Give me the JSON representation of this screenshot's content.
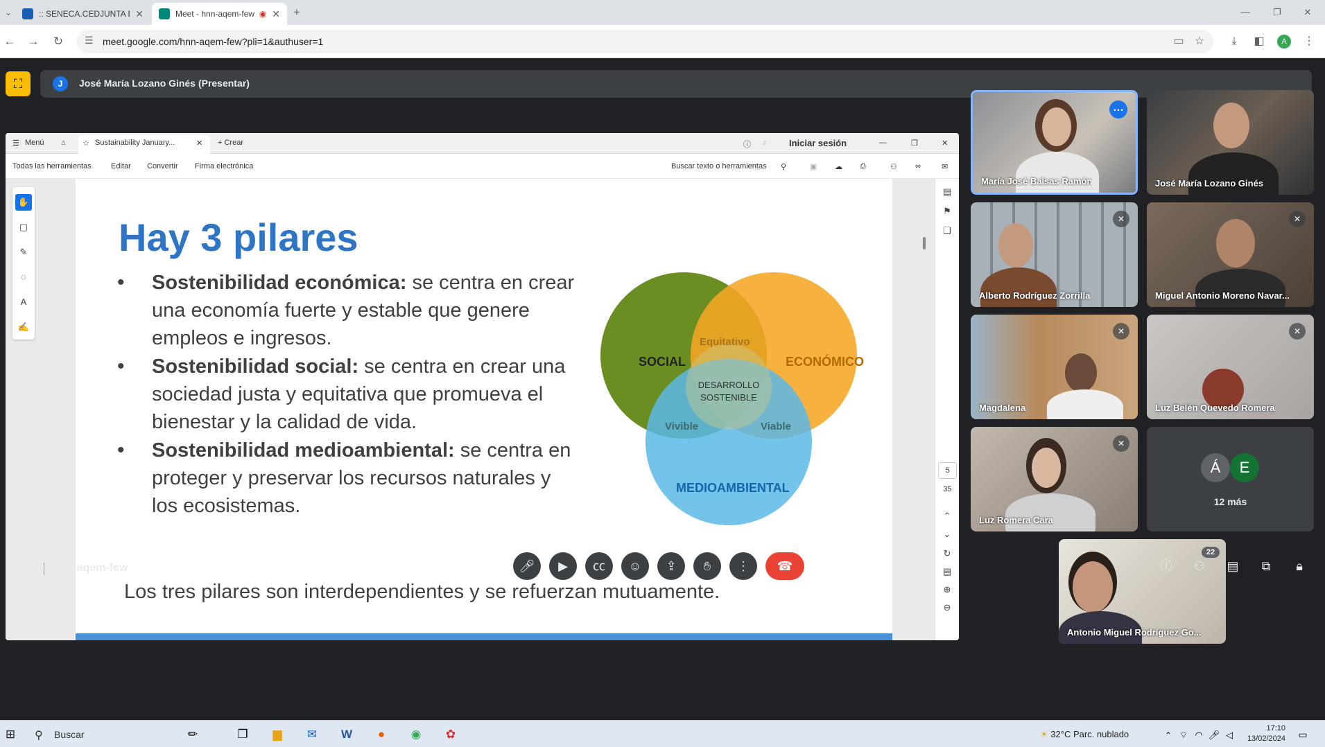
{
  "browser": {
    "tabs": [
      {
        "label": ":: SENECA.CEDJUNTA DE ANDALUCIA",
        "favicon_color": "#1a5fb4"
      },
      {
        "label": "Meet - hnn-aqem-few",
        "favicon_color": "#00897b"
      }
    ],
    "url": "meet.google.com/hnn-aqem-few?pli=1&authuser=1",
    "profile_initial": "A"
  },
  "meet": {
    "presenter_initial": "J",
    "presenter_label": "José María Lozano Ginés (Presentar)",
    "time": "17:10",
    "meeting_code": "hnn-aqem-few",
    "participants_count": "22",
    "more_label": "12 más",
    "more_initials": [
      "Á",
      "E"
    ],
    "tiles": [
      {
        "name": "María José Balsas Ramón"
      },
      {
        "name": "José María Lozano Ginés"
      },
      {
        "name": "Alberto Rodríguez Zorrilla"
      },
      {
        "name": "Miguel Antonio Moreno Navar..."
      },
      {
        "name": "Magdalena"
      },
      {
        "name": "Luz Belén Quevedo Romera"
      },
      {
        "name": "Luz Romera Cara"
      },
      {
        "name": "Antonio Miguel Rodríguez Go..."
      }
    ]
  },
  "acrobat": {
    "menu": "Menú",
    "doc_tab": "Sustainability January...",
    "create": "Crear",
    "sign_in": "Iniciar sesión",
    "toolbar": [
      "Todas las herramientas",
      "Editar",
      "Convertir",
      "Firma electrónica"
    ],
    "search": "Buscar texto o herramientas",
    "page_current": "5",
    "page_total": "35"
  },
  "slide": {
    "title": "Hay 3 pilares",
    "bullets": [
      {
        "bold": "Sostenibilidad económica:",
        "text": " se centra en crear una economía fuerte y estable que genere empleos e ingresos."
      },
      {
        "bold": "Sostenibilidad social:",
        "text": " se centra en crear una sociedad justa y equitativa que promueva el bienestar y la calidad de vida."
      },
      {
        "bold": "Sostenibilidad medioambiental:",
        "text": " se centra en proteger y preservar los recursos naturales y los ecosistemas."
      }
    ],
    "footer": "Los tres pilares son interdependientes y se refuerzan mutuamente.",
    "venn": {
      "social": "SOCIAL",
      "economico": "ECONÓMICO",
      "medioambiental": "MEDIOAMBIENTAL",
      "equitativo": "Equitativo",
      "vivible": "Vivible",
      "viable": "Viable",
      "center1": "DESARROLLO",
      "center2": "SOSTENIBLE",
      "colors": {
        "social": "#6b8e23",
        "economico": "#f5a623",
        "medio": "#5bb8e8"
      }
    }
  },
  "taskbar": {
    "search": "Buscar",
    "weather": "32°C  Parc. nublado",
    "clock_time": "17:10",
    "clock_date": "13/02/2024"
  }
}
